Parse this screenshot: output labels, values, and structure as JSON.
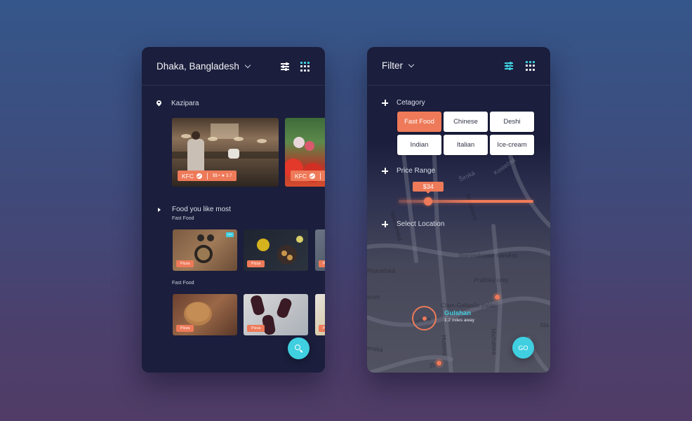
{
  "left_panel": {
    "header": {
      "location": "Dhaka, Bangladesh",
      "filter_icon": "sliders-icon",
      "menu_icon": "grid-icon"
    },
    "area": {
      "icon": "pin-icon",
      "label": "Kazipara"
    },
    "featured": [
      {
        "name": "KFC",
        "verified": true,
        "price": "$$",
        "rating": "3.7",
        "meta": "$$ • ★ 3.7",
        "image": "restaurant-kitchen"
      },
      {
        "name": "KFC",
        "verified": true,
        "image": "vegetables"
      }
    ],
    "favorites": {
      "icon": "triangle-right-icon",
      "title": "Food you like most",
      "groups": [
        {
          "label": "Fast Food",
          "items": [
            {
              "tag": "Pizza",
              "badge": "New",
              "image": "pan-dish"
            },
            {
              "tag": "Pizza",
              "image": "flowers-plate"
            },
            {
              "tag": "Pizza",
              "image": "partial"
            }
          ]
        },
        {
          "label": "Fast Food",
          "items": [
            {
              "tag": "Pizza",
              "image": "cookies"
            },
            {
              "tag": "Pizza",
              "image": "berry-eclairs"
            },
            {
              "tag": "Pizza",
              "image": "partial"
            }
          ]
        }
      ]
    },
    "fab": {
      "icon": "search-icon"
    }
  },
  "right_panel": {
    "header": {
      "title": "Filter",
      "filter_icon": "sliders-icon",
      "menu_icon": "grid-icon"
    },
    "category": {
      "label": "Cetagory",
      "options": [
        {
          "label": "Fast Food",
          "selected": true
        },
        {
          "label": "Chinese",
          "selected": false
        },
        {
          "label": "Deshi",
          "selected": false
        },
        {
          "label": "Indian",
          "selected": false
        },
        {
          "label": "Italian",
          "selected": false
        },
        {
          "label": "Ice-cream",
          "selected": false
        }
      ]
    },
    "price_range": {
      "label": "Price Range",
      "value_label": "$34",
      "value_fraction": 0.22
    },
    "select_location": {
      "label": "Select Location",
      "selected": {
        "name": "Gulshan",
        "distance": "1.2 miles away"
      }
    },
    "map_labels": [
      "Staroměstské náměstí",
      "Platnéřská",
      "Pražský orloj",
      "Clam-Gallasův palác",
      "Karlova",
      "Husova",
      "Michalská",
      "Zlatá",
      "Kostečná",
      "Široká",
      "Valentinská",
      "Kaprova",
      "Maiselova",
      "inum",
      "enská",
      "Sta"
    ],
    "fab": {
      "label": "GO"
    }
  },
  "colors": {
    "accent": "#ee7a59",
    "cyan": "#3fcfe0",
    "panel": "#1b1e3c"
  }
}
